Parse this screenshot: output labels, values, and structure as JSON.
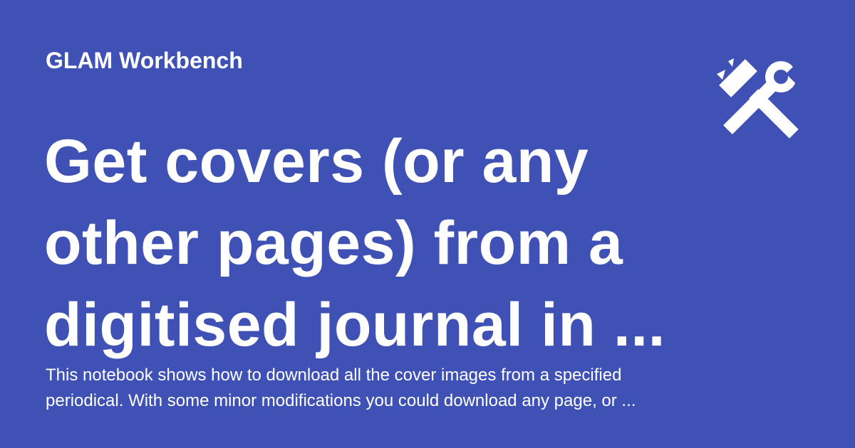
{
  "colors": {
    "background": "#3f51b5",
    "text": "#ffffff"
  },
  "site": {
    "name": "GLAM Workbench",
    "logo_icon": "hammer-wrench-icon"
  },
  "title": {
    "lines": [
      "Get covers (or any",
      "other pages) from a",
      "digitised journal in ..."
    ]
  },
  "description": {
    "lines": [
      "This notebook shows how to download all the cover images from a specified",
      "periodical. With some minor modifications you could download any page, or ..."
    ]
  }
}
